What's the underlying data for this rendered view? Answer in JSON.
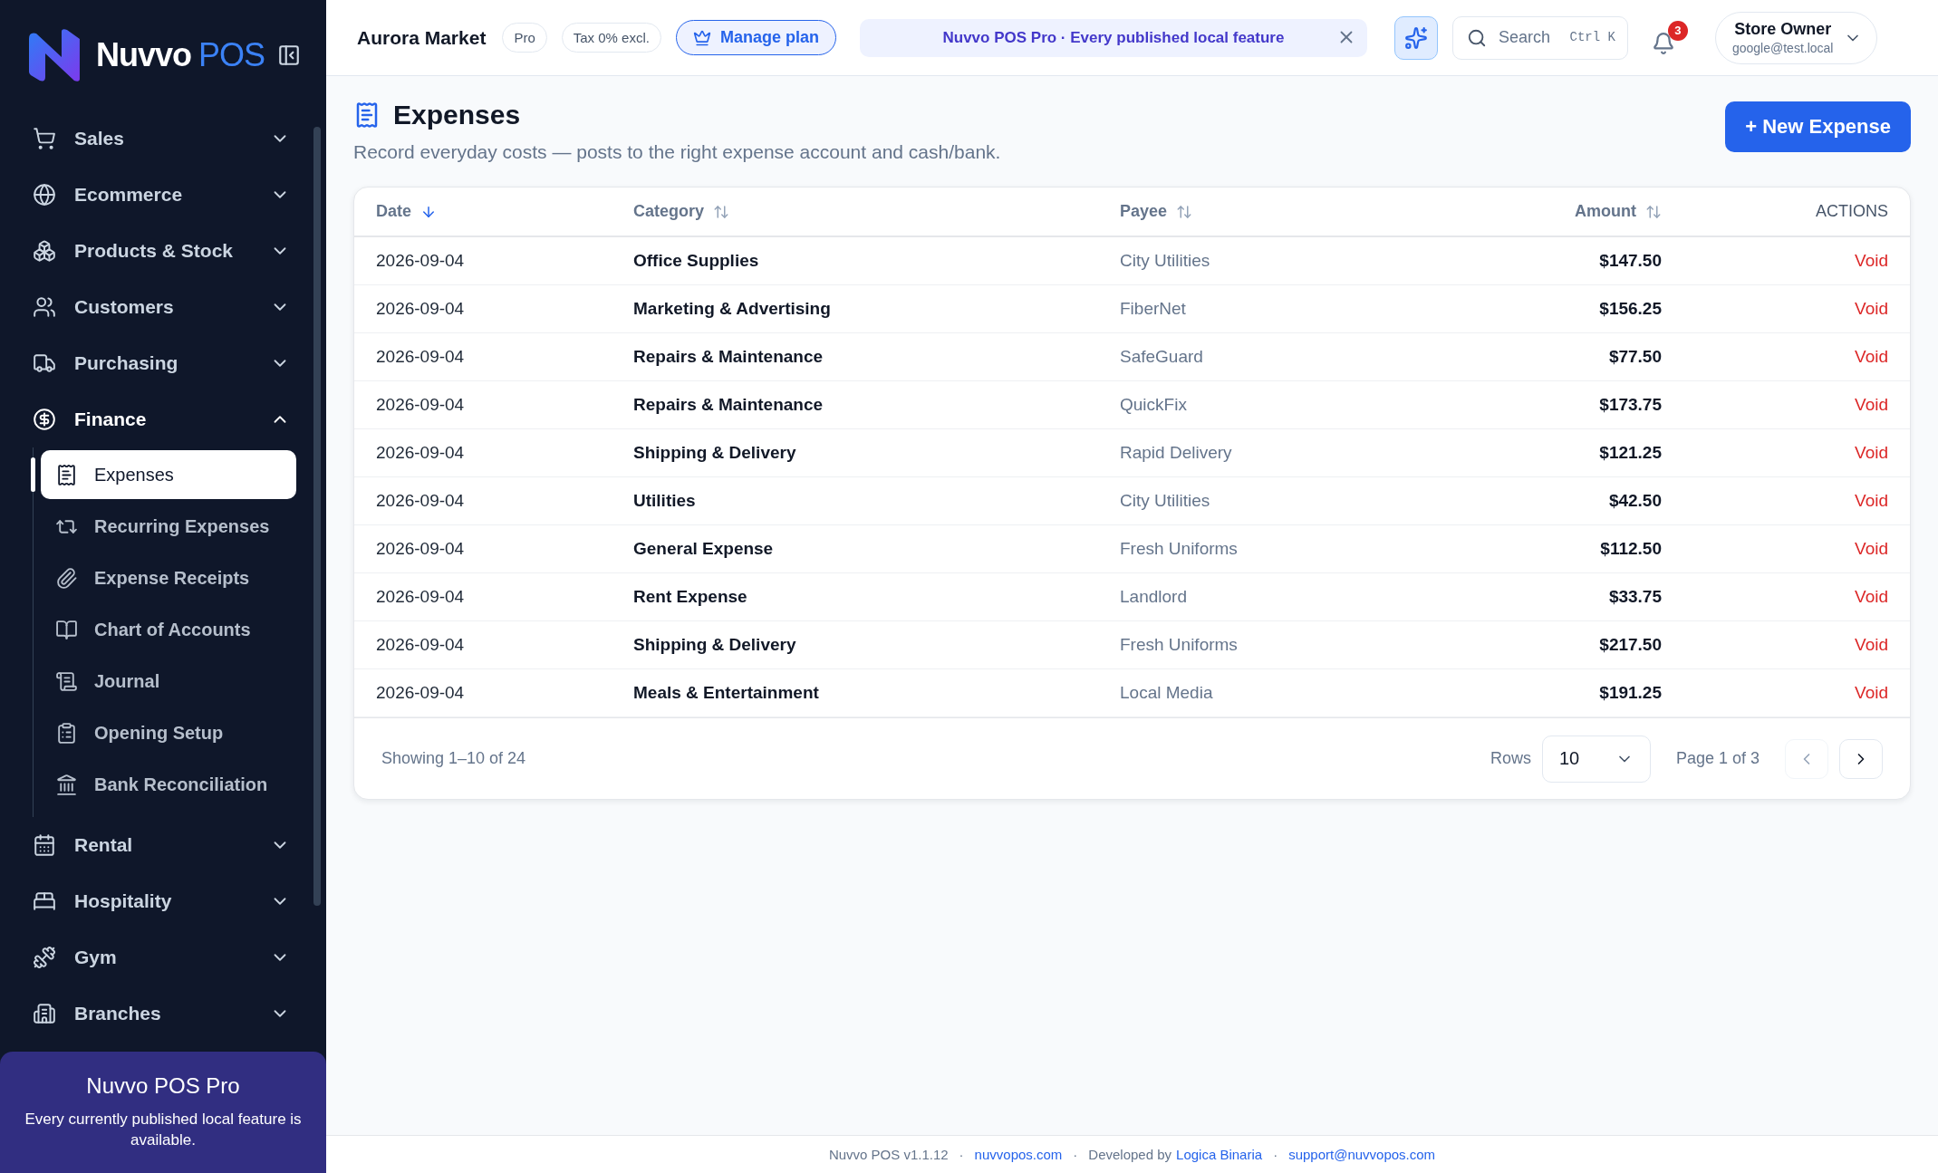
{
  "brand": {
    "name": "Nuvvo",
    "suffix": "POS"
  },
  "sidebar": {
    "items": [
      {
        "label": "Sales",
        "expanded": false
      },
      {
        "label": "Ecommerce",
        "expanded": false
      },
      {
        "label": "Products & Stock",
        "expanded": false
      },
      {
        "label": "Customers",
        "expanded": false
      },
      {
        "label": "Purchasing",
        "expanded": false
      },
      {
        "label": "Finance",
        "expanded": true,
        "children": [
          {
            "label": "Expenses",
            "selected": true
          },
          {
            "label": "Recurring Expenses",
            "selected": false
          },
          {
            "label": "Expense Receipts",
            "selected": false
          },
          {
            "label": "Chart of Accounts",
            "selected": false
          },
          {
            "label": "Journal",
            "selected": false
          },
          {
            "label": "Opening Setup",
            "selected": false
          },
          {
            "label": "Bank Reconciliation",
            "selected": false
          }
        ]
      },
      {
        "label": "Rental",
        "expanded": false
      },
      {
        "label": "Hospitality",
        "expanded": false
      },
      {
        "label": "Gym",
        "expanded": false
      },
      {
        "label": "Branches",
        "expanded": false
      }
    ]
  },
  "promo": {
    "title": "Nuvvo POS Pro",
    "text": "Every currently published local feature is available."
  },
  "header": {
    "store": "Aurora Market",
    "badges": [
      "Pro",
      "Tax 0% excl."
    ],
    "plan_button": "Manage plan",
    "banner": "Nuvvo POS Pro · Every published local feature",
    "search": {
      "placeholder": "Search",
      "shortcut": "Ctrl K"
    },
    "notifications": "3",
    "user": {
      "name": "Store Owner",
      "email": "google@test.local"
    }
  },
  "page": {
    "title": "Expenses",
    "subtitle": "Record everyday costs — posts to the right expense account and cash/bank.",
    "new_button": "+ New Expense"
  },
  "table": {
    "columns": [
      {
        "label": "Date",
        "sorted": true
      },
      {
        "label": "Category",
        "sorted": false
      },
      {
        "label": "Payee",
        "sorted": false
      },
      {
        "label": "Amount",
        "sorted": false
      },
      {
        "label": "ACTIONS"
      }
    ],
    "rows": [
      {
        "date": "2026-09-04",
        "category": "Office Supplies",
        "payee": "City Utilities",
        "amount": "$147.50",
        "action": "Void"
      },
      {
        "date": "2026-09-04",
        "category": "Marketing & Advertising",
        "payee": "FiberNet",
        "amount": "$156.25",
        "action": "Void"
      },
      {
        "date": "2026-09-04",
        "category": "Repairs & Maintenance",
        "payee": "SafeGuard",
        "amount": "$77.50",
        "action": "Void"
      },
      {
        "date": "2026-09-04",
        "category": "Repairs & Maintenance",
        "payee": "QuickFix",
        "amount": "$173.75",
        "action": "Void"
      },
      {
        "date": "2026-09-04",
        "category": "Shipping & Delivery",
        "payee": "Rapid Delivery",
        "amount": "$121.25",
        "action": "Void"
      },
      {
        "date": "2026-09-04",
        "category": "Utilities",
        "payee": "City Utilities",
        "amount": "$42.50",
        "action": "Void"
      },
      {
        "date": "2026-09-04",
        "category": "General Expense",
        "payee": "Fresh Uniforms",
        "amount": "$112.50",
        "action": "Void"
      },
      {
        "date": "2026-09-04",
        "category": "Rent Expense",
        "payee": "Landlord",
        "amount": "$33.75",
        "action": "Void"
      },
      {
        "date": "2026-09-04",
        "category": "Shipping & Delivery",
        "payee": "Fresh Uniforms",
        "amount": "$217.50",
        "action": "Void"
      },
      {
        "date": "2026-09-04",
        "category": "Meals & Entertainment",
        "payee": "Local Media",
        "amount": "$191.25",
        "action": "Void"
      }
    ]
  },
  "pagination": {
    "summary": "Showing 1–10 of 24",
    "rows_label": "Rows",
    "rows_value": "10",
    "page": "Page 1 of 3",
    "prev_disabled": true,
    "next_disabled": false
  },
  "footer": {
    "separator": "·",
    "parts": [
      {
        "text": "Nuvvo POS v1.1.12"
      },
      {
        "link": "nuvvopos.com"
      },
      {
        "text": "Developed by",
        "link": "Logica Binaria"
      },
      {
        "link": "support@nuvvopos.com"
      }
    ]
  }
}
